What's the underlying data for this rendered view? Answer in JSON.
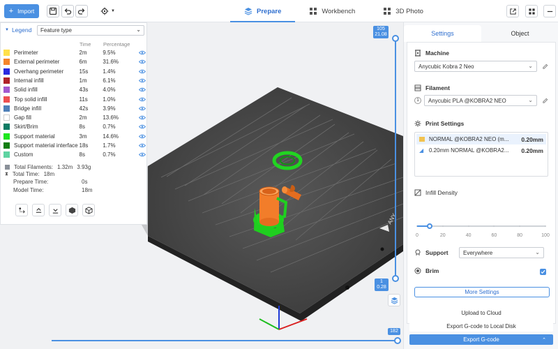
{
  "toolbar": {
    "import_label": "Import",
    "tabs": [
      {
        "label": "Prepare",
        "icon": "layers-icon",
        "active": true
      },
      {
        "label": "Workbench",
        "icon": "grid-icon",
        "active": false
      },
      {
        "label": "3D Photo",
        "icon": "tiles-icon",
        "active": false
      }
    ]
  },
  "legend": {
    "title": "Legend",
    "selector": "Feature type",
    "headers": {
      "time": "Time",
      "percentage": "Percentage"
    },
    "items": [
      {
        "name": "Perimeter",
        "time": "2m",
        "pct": "9.5%",
        "color": "#ffe04a"
      },
      {
        "name": "External perimeter",
        "time": "6m",
        "pct": "31.6%",
        "color": "#f5842b"
      },
      {
        "name": "Overhang perimeter",
        "time": "15s",
        "pct": "1.4%",
        "color": "#2a2ae0"
      },
      {
        "name": "Internal infill",
        "time": "1m",
        "pct": "6.1%",
        "color": "#b0232a"
      },
      {
        "name": "Solid infill",
        "time": "43s",
        "pct": "4.0%",
        "color": "#a35ad0"
      },
      {
        "name": "Top solid infill",
        "time": "11s",
        "pct": "1.0%",
        "color": "#ee5050"
      },
      {
        "name": "Bridge infill",
        "time": "42s",
        "pct": "3.9%",
        "color": "#4f80b8"
      },
      {
        "name": "Gap fill",
        "time": "2m",
        "pct": "13.6%",
        "color": "#ffffff"
      },
      {
        "name": "Skirt/Brim",
        "time": "8s",
        "pct": "0.7%",
        "color": "#0c7b64"
      },
      {
        "name": "Support material",
        "time": "3m",
        "pct": "14.6%",
        "color": "#1fe61f"
      },
      {
        "name": "Support material interface",
        "time": "18s",
        "pct": "1.7%",
        "color": "#127d12"
      },
      {
        "name": "Custom",
        "time": "8s",
        "pct": "0.7%",
        "color": "#5ed3a2"
      }
    ],
    "total_filaments_label": "Total Filaments:",
    "total_filaments_length": "1.32m",
    "total_filaments_weight": "3.93g",
    "total_time_label": "Total Time:",
    "total_time": "18m",
    "prepare_time_label": "Prepare Time:",
    "prepare_time": "0s",
    "model_time_label": "Model Time:",
    "model_time": "18m"
  },
  "viewport": {
    "layer_top_value": "105",
    "layer_top_height": "21.08",
    "layer_bottom_value": "1",
    "layer_bottom_height": "0.28",
    "move_value": "182"
  },
  "right_panel": {
    "tabs": [
      "Settings",
      "Object"
    ],
    "machine_label": "Machine",
    "machine_value": "Anycubic Kobra 2 Neo",
    "filament_label": "Filament",
    "filament_index": "1",
    "filament_value": "Anycubic PLA @KOBRA2 NEO",
    "print_settings_label": "Print Settings",
    "print_settings": [
      {
        "name": "NORMAL @KOBRA2 NEO (m...",
        "value": "0.20mm"
      },
      {
        "name": "0.20mm NORMAL @KOBRA2...",
        "value": "0.20mm"
      }
    ],
    "infill_label": "Infill Density",
    "infill_ticks": [
      "0",
      "20",
      "40",
      "60",
      "80",
      "100"
    ],
    "infill_value": 10,
    "support_label": "Support",
    "support_value": "Everywhere",
    "brim_label": "Brim",
    "more_settings": "More Settings",
    "upload_cloud": "Upload to Cloud",
    "export_local": "Export G-code to Local Disk",
    "export_gcode": "Export G-code"
  }
}
